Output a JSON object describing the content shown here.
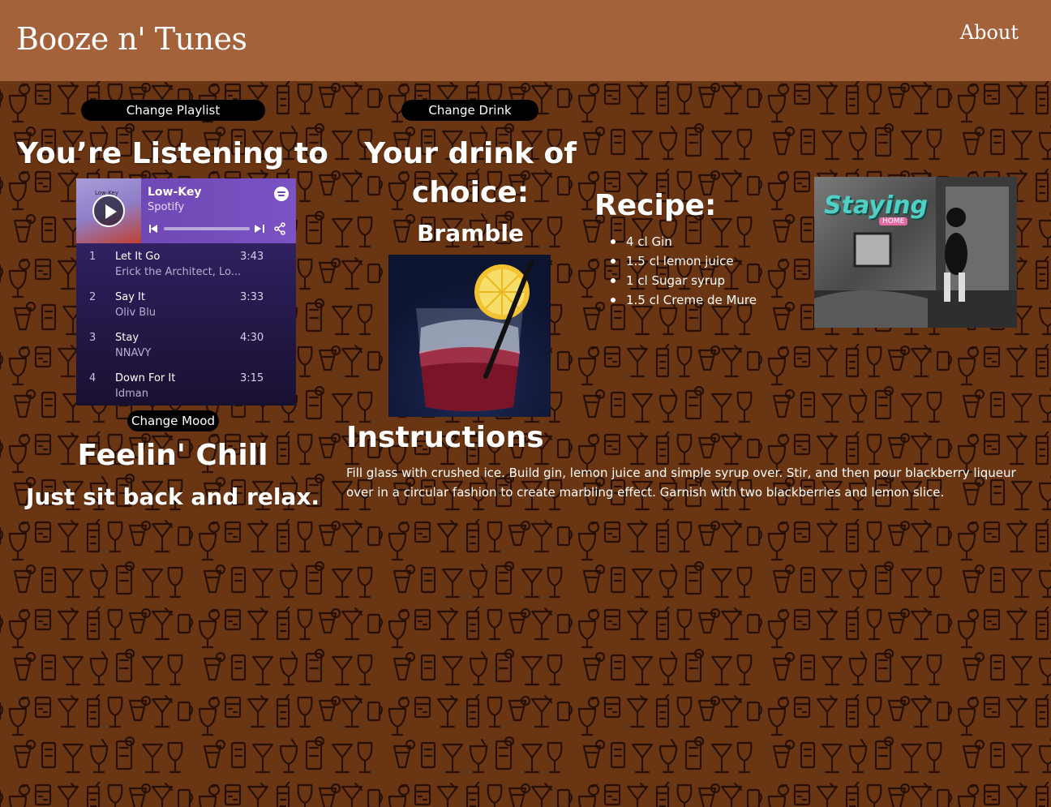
{
  "header": {
    "title": "Booze n' Tunes",
    "nav_about": "About"
  },
  "music": {
    "change_playlist_label": "Change Playlist",
    "heading": "You’re Listening to",
    "change_mood_label": "Change Mood",
    "mood_title": "Feelin' Chill",
    "mood_subtitle": "Just sit back and relax.",
    "player": {
      "cover_label": "Low-Key",
      "song": "Low-Key",
      "source": "Spotify",
      "tracks": [
        {
          "num": "1",
          "name": "Let It Go",
          "artist": "Erick the Architect, Lo...",
          "duration": "3:43"
        },
        {
          "num": "2",
          "name": "Say It",
          "artist": "Oliv Blu",
          "duration": "3:33"
        },
        {
          "num": "3",
          "name": "Stay",
          "artist": "NNAVY",
          "duration": "4:30"
        },
        {
          "num": "4",
          "name": "Down For It",
          "artist": "Idman",
          "duration": "3:15"
        }
      ]
    }
  },
  "drink": {
    "change_drink_label": "Change Drink",
    "heading": "Your drink of choice:",
    "name": "Bramble",
    "recipe_heading": "Recipe:",
    "ingredients": [
      "4 cl Gin",
      "1.5 cl lemon juice",
      "1 cl Sugar syrup",
      "1.5 cl Creme de Mure"
    ],
    "instructions_heading": "Instructions",
    "instructions": "Fill glass with crushed ice. Build gin, lemon juice and simple syrup over. Stir, and then pour blackberry liqueur over in a circular fashion to create marbling effect. Garnish with two blackberries and lemon slice."
  },
  "gif": {
    "title": "Staying",
    "subtitle": "HOME"
  },
  "colors": {
    "header_bg": "#a3623a",
    "page_bg": "#6a3512",
    "pattern_stroke": "#1a0a02",
    "button_bg": "#000000"
  }
}
